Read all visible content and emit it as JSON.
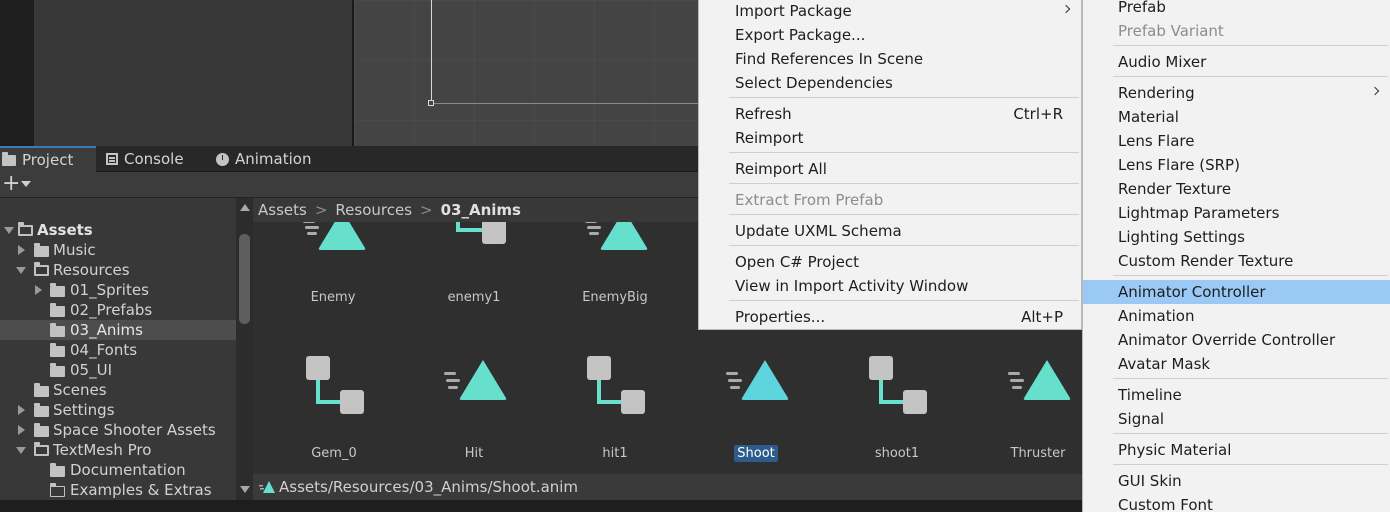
{
  "tabs": [
    {
      "label": "Project",
      "icon": "folder-icon",
      "active": true
    },
    {
      "label": "Console",
      "icon": "console-icon",
      "active": false
    },
    {
      "label": "Animation",
      "icon": "animation-clock-icon",
      "active": false
    }
  ],
  "toolbar": {
    "create_label": "+"
  },
  "tree": [
    {
      "label": "Assets",
      "bold": true
    },
    {
      "label": "Music"
    },
    {
      "label": "Resources"
    },
    {
      "label": "01_Sprites"
    },
    {
      "label": "02_Prefabs"
    },
    {
      "label": "03_Anims",
      "selected": true
    },
    {
      "label": "04_Fonts"
    },
    {
      "label": "05_UI"
    },
    {
      "label": "Scenes"
    },
    {
      "label": "Settings"
    },
    {
      "label": "Space Shooter Assets"
    },
    {
      "label": "TextMesh Pro"
    },
    {
      "label": "Documentation"
    },
    {
      "label": "Examples & Extras"
    }
  ],
  "breadcrumb": {
    "items": [
      "Assets",
      "Resources"
    ],
    "current": "03_Anims",
    "separator": ">"
  },
  "assets": [
    {
      "name": "Enemy",
      "kind": "animation-clip-icon"
    },
    {
      "name": "enemy1",
      "kind": "animator-controller-icon"
    },
    {
      "name": "EnemyBig",
      "kind": "animation-clip-icon"
    },
    {
      "name": "Gem_0",
      "kind": "animator-controller-icon"
    },
    {
      "name": "Hit",
      "kind": "animation-clip-icon"
    },
    {
      "name": "hit1",
      "kind": "animator-controller-icon"
    },
    {
      "name": "Shoot",
      "kind": "animation-clip-icon",
      "selected": true
    },
    {
      "name": "shoot1",
      "kind": "animator-controller-icon"
    },
    {
      "name": "Thruster",
      "kind": "animation-clip-icon"
    }
  ],
  "status": {
    "path": "Assets/Resources/03_Anims/Shoot.anim"
  },
  "context_menu": {
    "items": {
      "import_package": "Import Package",
      "export_package": "Export Package...",
      "find_references": "Find References In Scene",
      "select_dependencies": "Select Dependencies",
      "refresh": "Refresh",
      "refresh_shortcut": "Ctrl+R",
      "reimport": "Reimport",
      "reimport_all": "Reimport All",
      "extract_prefab": "Extract From Prefab",
      "update_uxml": "Update UXML Schema",
      "open_csharp": "Open C# Project",
      "view_import": "View in Import Activity Window",
      "properties": "Properties...",
      "properties_shortcut": "Alt+P"
    }
  },
  "create_submenu": {
    "items": {
      "prefab": "Prefab",
      "prefab_variant": "Prefab Variant",
      "audio_mixer": "Audio Mixer",
      "rendering": "Rendering",
      "material": "Material",
      "lens_flare": "Lens Flare",
      "lens_flare_srp": "Lens Flare (SRP)",
      "render_texture": "Render Texture",
      "lightmap_parameters": "Lightmap Parameters",
      "lighting_settings": "Lighting Settings",
      "custom_render_texture": "Custom Render Texture",
      "animator_controller": "Animator Controller",
      "animation": "Animation",
      "animator_override": "Animator Override Controller",
      "avatar_mask": "Avatar Mask",
      "timeline": "Timeline",
      "signal": "Signal",
      "physic_material": "Physic Material",
      "gui_skin": "GUI Skin",
      "custom_font": "Custom Font"
    }
  },
  "colors": {
    "accent_teal": "#66e0cc",
    "menu_highlight": "#99c9f4",
    "selection_blue": "#2d5c8c"
  }
}
